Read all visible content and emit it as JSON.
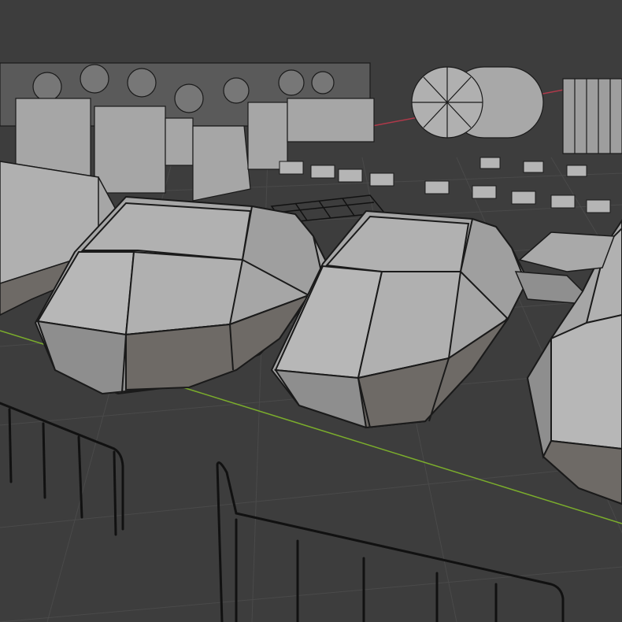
{
  "viewport": {
    "background_color": "#3d3d3d",
    "grid_line_color": "#4a4a4a",
    "x_axis_color": "#b0394a",
    "y_axis_color": "#7bad2c",
    "mesh_face_color": "#a6a6a6",
    "mesh_shadow_color": "#6e6a66",
    "mesh_edge_color": "#1a1a1a",
    "wireframe_color": "#111111"
  },
  "objects": [
    {
      "name": "pod-left",
      "kind": "pod"
    },
    {
      "name": "pod-center",
      "kind": "pod"
    },
    {
      "name": "pod-right-partial",
      "kind": "pod"
    },
    {
      "name": "block-left-partial",
      "kind": "block"
    },
    {
      "name": "railing-left",
      "kind": "railing"
    },
    {
      "name": "railing-front",
      "kind": "railing"
    },
    {
      "name": "cylinder-tank",
      "kind": "tank"
    },
    {
      "name": "cage-container",
      "kind": "cage"
    },
    {
      "name": "grate-mesh",
      "kind": "grate"
    },
    {
      "name": "crate-pile",
      "kind": "crates"
    },
    {
      "name": "engine-cluster",
      "kind": "engines"
    },
    {
      "name": "bolt-row",
      "kind": "bolts"
    }
  ]
}
